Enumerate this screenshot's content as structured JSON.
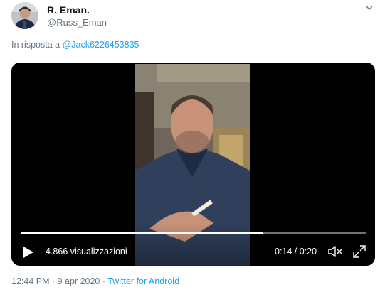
{
  "author": {
    "name": "R. Eman.",
    "handle": "@Russ_Eman"
  },
  "reply": {
    "prefix": "In risposta a ",
    "mention": "@Jack6226453835"
  },
  "video": {
    "views": "4.866 visualizzazioni",
    "time": "0:14 / 0:20",
    "progress_fraction": 0.7
  },
  "meta": {
    "timestamp": "12:44 PM · 9 apr 2020",
    "separator": " · ",
    "source": "Twitter for Android"
  },
  "colors": {
    "link": "#1da1f2",
    "secondary_text": "#657786"
  },
  "icons": {
    "menu": "chevron-down-icon",
    "play": "play-icon",
    "mute": "volume-muted-icon",
    "fullscreen": "fullscreen-icon"
  }
}
